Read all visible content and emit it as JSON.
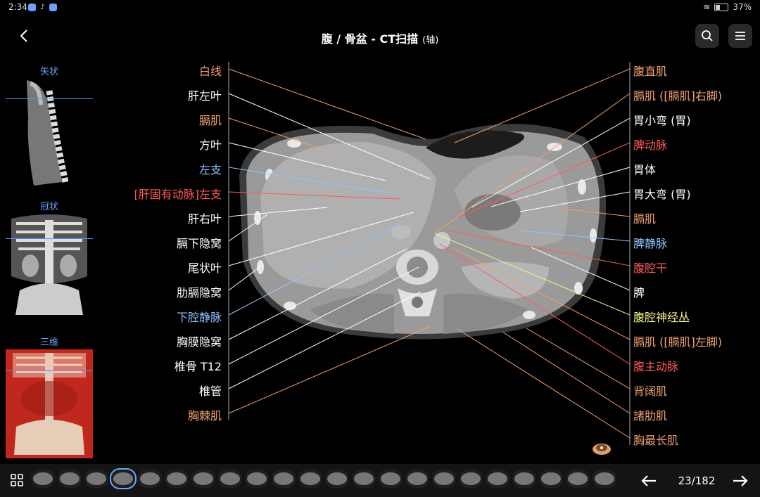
{
  "status": {
    "time": "2:34",
    "battery": "37%"
  },
  "header": {
    "title": "腹 / 骨盆 - CT扫描",
    "subtitle": "(轴)"
  },
  "views": [
    {
      "label": "矢状"
    },
    {
      "label": "冠状"
    },
    {
      "label": "三维"
    }
  ],
  "left_labels": [
    {
      "text": "白线",
      "color": "#f0a070"
    },
    {
      "text": "肝左叶",
      "color": "#ffffff"
    },
    {
      "text": "膈肌",
      "color": "#f0a070"
    },
    {
      "text": "方叶",
      "color": "#ffffff"
    },
    {
      "text": "左支",
      "color": "#8fc4ff"
    },
    {
      "text": "[肝固有动脉]左支",
      "color": "#ff5a5a"
    },
    {
      "text": "肝右叶",
      "color": "#ffffff"
    },
    {
      "text": "膈下隐窝",
      "color": "#ffffff"
    },
    {
      "text": "尾状叶",
      "color": "#ffffff"
    },
    {
      "text": "肋膈隐窝",
      "color": "#ffffff"
    },
    {
      "text": "下腔静脉",
      "color": "#8fc4ff"
    },
    {
      "text": "胸膜隐窝",
      "color": "#ffffff"
    },
    {
      "text": "椎骨 T12",
      "color": "#ffffff"
    },
    {
      "text": "椎管",
      "color": "#ffffff"
    },
    {
      "text": "胸棘肌",
      "color": "#f0a070"
    }
  ],
  "right_labels": [
    {
      "text": "腹直肌",
      "color": "#f0a070"
    },
    {
      "text": "膈肌 ([膈肌]右脚)",
      "color": "#f0a070"
    },
    {
      "text": "胃小弯 (胃)",
      "color": "#ffffff"
    },
    {
      "text": "脾动脉",
      "color": "#ff5a5a"
    },
    {
      "text": "胃体",
      "color": "#ffffff"
    },
    {
      "text": "胃大弯 (胃)",
      "color": "#ffffff"
    },
    {
      "text": "膈肌",
      "color": "#f0a070"
    },
    {
      "text": "脾静脉",
      "color": "#8fc4ff"
    },
    {
      "text": "腹腔干",
      "color": "#ff5a5a"
    },
    {
      "text": "脾",
      "color": "#ffffff"
    },
    {
      "text": "腹腔神经丛",
      "color": "#f5f58a"
    },
    {
      "text": "膈肌 ([膈肌]左脚)",
      "color": "#f0a070"
    },
    {
      "text": "腹主动脉",
      "color": "#ff5a5a"
    },
    {
      "text": "背阔肌",
      "color": "#f0a070"
    },
    {
      "text": "諸肋肌",
      "color": "#f0a070"
    },
    {
      "text": "胸最长肌",
      "color": "#f0a070"
    }
  ],
  "pager": {
    "current": 23,
    "total": 182,
    "text": "23/182"
  }
}
